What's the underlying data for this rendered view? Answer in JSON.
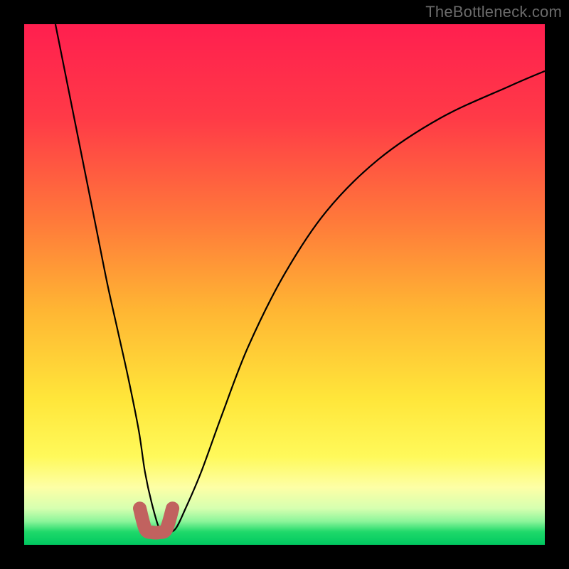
{
  "watermark": "TheBottleneck.com",
  "colors": {
    "frame": "#000000",
    "gradient_stops": [
      {
        "offset": 0.0,
        "color": "#ff1f4f"
      },
      {
        "offset": 0.18,
        "color": "#ff3a47"
      },
      {
        "offset": 0.38,
        "color": "#ff7a3a"
      },
      {
        "offset": 0.55,
        "color": "#ffb633"
      },
      {
        "offset": 0.72,
        "color": "#ffe63a"
      },
      {
        "offset": 0.83,
        "color": "#fff95a"
      },
      {
        "offset": 0.89,
        "color": "#fdffa6"
      },
      {
        "offset": 0.93,
        "color": "#d6ffb0"
      },
      {
        "offset": 0.955,
        "color": "#8cf59a"
      },
      {
        "offset": 0.975,
        "color": "#1fd96a"
      },
      {
        "offset": 1.0,
        "color": "#00c860"
      }
    ],
    "curve": "#000000",
    "bottom_marker": "#c1625f"
  },
  "chart_data": {
    "type": "line",
    "title": "",
    "xlabel": "",
    "ylabel": "",
    "xlim": [
      0,
      100
    ],
    "ylim": [
      0,
      100
    ],
    "grid": false,
    "series": [
      {
        "name": "bottleneck-curve",
        "x": [
          6,
          8,
          10,
          12,
          14,
          16,
          18,
          20,
          22,
          23.2,
          24.5,
          26,
          27.2,
          29,
          31,
          34,
          38,
          43,
          50,
          58,
          68,
          80,
          93,
          100
        ],
        "y": [
          100,
          90,
          80,
          70,
          60,
          50,
          41,
          32,
          22,
          14,
          8,
          3,
          2.5,
          3,
          7,
          14,
          25,
          38,
          52,
          64,
          74,
          82,
          88,
          91
        ]
      }
    ],
    "bottom_marker": {
      "name": "optimal-range-marker",
      "x": [
        22.2,
        23.3,
        24.6,
        26.0,
        27.3,
        28.5
      ],
      "y": [
        7.0,
        3.0,
        2.4,
        2.4,
        3.0,
        7.0
      ],
      "thickness_pct": 2.6,
      "endpoint_radius_pct": 1.2
    }
  }
}
